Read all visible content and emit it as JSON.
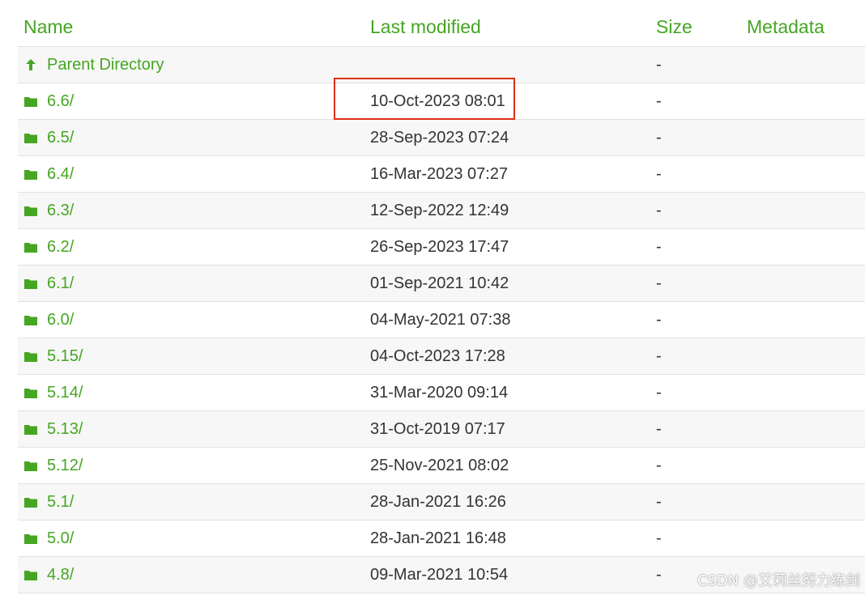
{
  "colors": {
    "accent": "#45a622",
    "highlight": "#d9301a",
    "text": "#333333"
  },
  "headers": {
    "name": "Name",
    "last_modified": "Last modified",
    "size": "Size",
    "metadata": "Metadata"
  },
  "parent": {
    "icon": "arrow-up-icon",
    "label": "Parent Directory",
    "size": "-"
  },
  "rows": [
    {
      "icon": "folder-icon",
      "name": "6.6/",
      "modified": "10-Oct-2023 08:01",
      "size": "-"
    },
    {
      "icon": "folder-icon",
      "name": "6.5/",
      "modified": "28-Sep-2023 07:24",
      "size": "-"
    },
    {
      "icon": "folder-icon",
      "name": "6.4/",
      "modified": "16-Mar-2023 07:27",
      "size": "-"
    },
    {
      "icon": "folder-icon",
      "name": "6.3/",
      "modified": "12-Sep-2022 12:49",
      "size": "-"
    },
    {
      "icon": "folder-icon",
      "name": "6.2/",
      "modified": "26-Sep-2023 17:47",
      "size": "-"
    },
    {
      "icon": "folder-icon",
      "name": "6.1/",
      "modified": "01-Sep-2021 10:42",
      "size": "-"
    },
    {
      "icon": "folder-icon",
      "name": "6.0/",
      "modified": "04-May-2021 07:38",
      "size": "-"
    },
    {
      "icon": "folder-icon",
      "name": "5.15/",
      "modified": "04-Oct-2023 17:28",
      "size": "-"
    },
    {
      "icon": "folder-icon",
      "name": "5.14/",
      "modified": "31-Mar-2020 09:14",
      "size": "-"
    },
    {
      "icon": "folder-icon",
      "name": "5.13/",
      "modified": "31-Oct-2019 07:17",
      "size": "-"
    },
    {
      "icon": "folder-icon",
      "name": "5.12/",
      "modified": "25-Nov-2021 08:02",
      "size": "-"
    },
    {
      "icon": "folder-icon",
      "name": "5.1/",
      "modified": "28-Jan-2021 16:26",
      "size": "-"
    },
    {
      "icon": "folder-icon",
      "name": "5.0/",
      "modified": "28-Jan-2021 16:48",
      "size": "-"
    },
    {
      "icon": "folder-icon",
      "name": "4.8/",
      "modified": "09-Mar-2021 10:54",
      "size": "-"
    }
  ],
  "watermark": "CSDN @艾莉丝努力练剑"
}
